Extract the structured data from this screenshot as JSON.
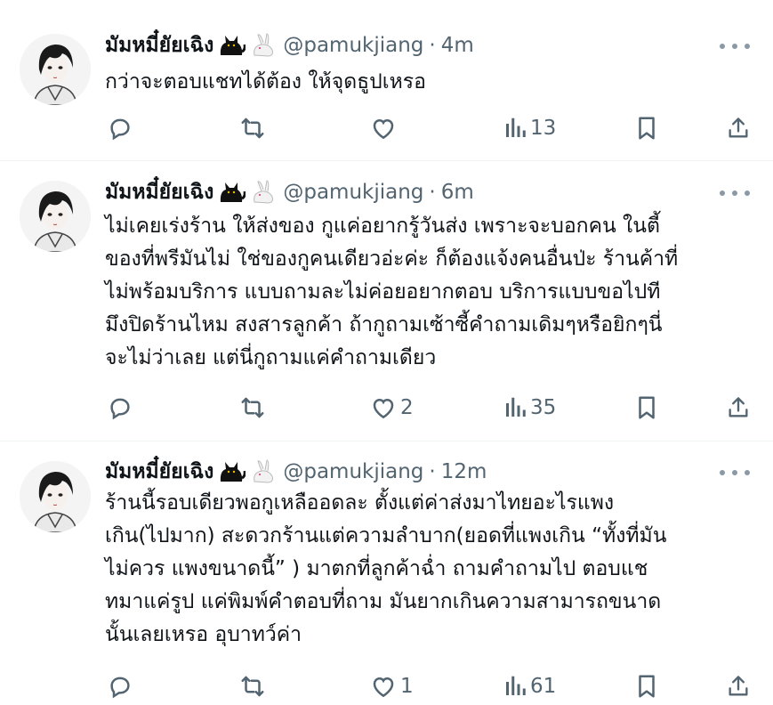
{
  "tweets": [
    {
      "name": "มัมหมี๋ยัยเฉิง",
      "handle": "@pamukjiang",
      "separator": "·",
      "time": "4m",
      "lines": [
        "กว่าจะตอบแชทได้ต้อง ให้จุดธูปเหรอ"
      ],
      "likes": "",
      "views": "13"
    },
    {
      "name": "มัมหมี๋ยัยเฉิง",
      "handle": "@pamukjiang",
      "separator": "·",
      "time": "6m",
      "lines": [
        "ไม่เคยเร่งร้าน ให้ส่งของ กูแค่อยากรู้วันส่ง เพราะจะบอกคน ในตี้",
        "ของที่พรีมันไม่ ใช่ของกูคนเดียวอ่ะค่ะ ก็ต้องแจ้งคนอื่นป่ะ ร้านค้าที่",
        "ไม่พร้อมบริการ แบบถามละไม่ค่อยอยากตอบ บริการแบบขอไปที",
        "มึงปิดร้านไหม สงสารลูกค้า ถ้ากูถามเซ้าซี้คำถามเดิมๆหรือยิกๆนี่",
        "จะไม่ว่าเลย แต่นี่กูถามแค่คำถามเดียว"
      ],
      "likes": "2",
      "views": "35"
    },
    {
      "name": "มัมหมี๋ยัยเฉิง",
      "handle": "@pamukjiang",
      "separator": "·",
      "time": "12m",
      "lines": [
        "ร้านนี้รอบเดียวพอกูเหลืออดละ ตั้งแต่ค่าส่งมาไทยอะไรแพง",
        "เกิน(ไปมาก) สะดวกร้านแต่ความลำบาก(ยอดที่แพงเกิน “ทั้งที่มัน",
        "ไม่ควร แพงขนาดนี้” ) มาตกที่ลูกค้าฉ่ำ ถามคำถามไป ตอบแช",
        "ทมาแค่รูป แค่พิมพ์คำตอบที่ถาม มันยากเกินความสามารถขนาด",
        "นั้นเลยเหรอ อุบาทว์ค่า"
      ],
      "likes": "1",
      "views": "61"
    }
  ],
  "icons": {
    "reply": "reply-icon",
    "retweet": "retweet-icon",
    "like": "like-icon",
    "views": "views-icon",
    "bookmark": "bookmark-icon",
    "share": "share-icon",
    "more": "more-icon",
    "cat": "black-cat-icon",
    "rabbit": "rabbit-icon"
  },
  "colors": {
    "text": "#0f1419",
    "secondary": "#536471",
    "divider": "#eff3f4"
  }
}
